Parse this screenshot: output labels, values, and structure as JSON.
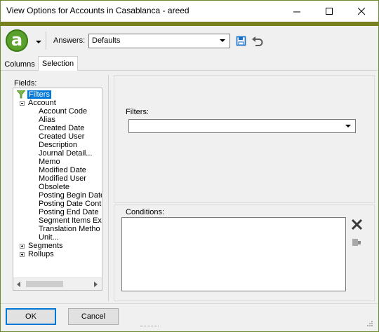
{
  "window": {
    "title": "View Options for Accounts in Casablanca - areed"
  },
  "colors": {
    "accent_bar": "#77801c",
    "logo_green": "#5aa02c",
    "selection_blue": "#0078d7",
    "save_icon_blue": "#1a73c9"
  },
  "toolbar": {
    "logo_letter": "a",
    "answers_label": "Answers:",
    "answers_value": "Defaults"
  },
  "tabs": [
    {
      "label": "Columns"
    },
    {
      "label": "Selection"
    }
  ],
  "fields": {
    "label": "Fields:",
    "tree": {
      "root": "Filters",
      "account": "Account",
      "account_items": [
        "Account Code",
        "Alias",
        "Created Date",
        "Created User",
        "Description",
        "Journal Detail...",
        "Memo",
        "Modified Date",
        "Modified User",
        "Obsolete",
        "Posting Begin Date",
        "Posting Date Cont",
        "Posting End Date",
        "Segment Items Ex",
        "Translation Metho",
        "Unit..."
      ],
      "segments": "Segments",
      "rollups": "Rollups"
    }
  },
  "filters": {
    "label": "Filters:",
    "value": ""
  },
  "conditions": {
    "label": "Conditions:"
  },
  "buttons": {
    "ok": "OK",
    "cancel": "Cancel"
  }
}
